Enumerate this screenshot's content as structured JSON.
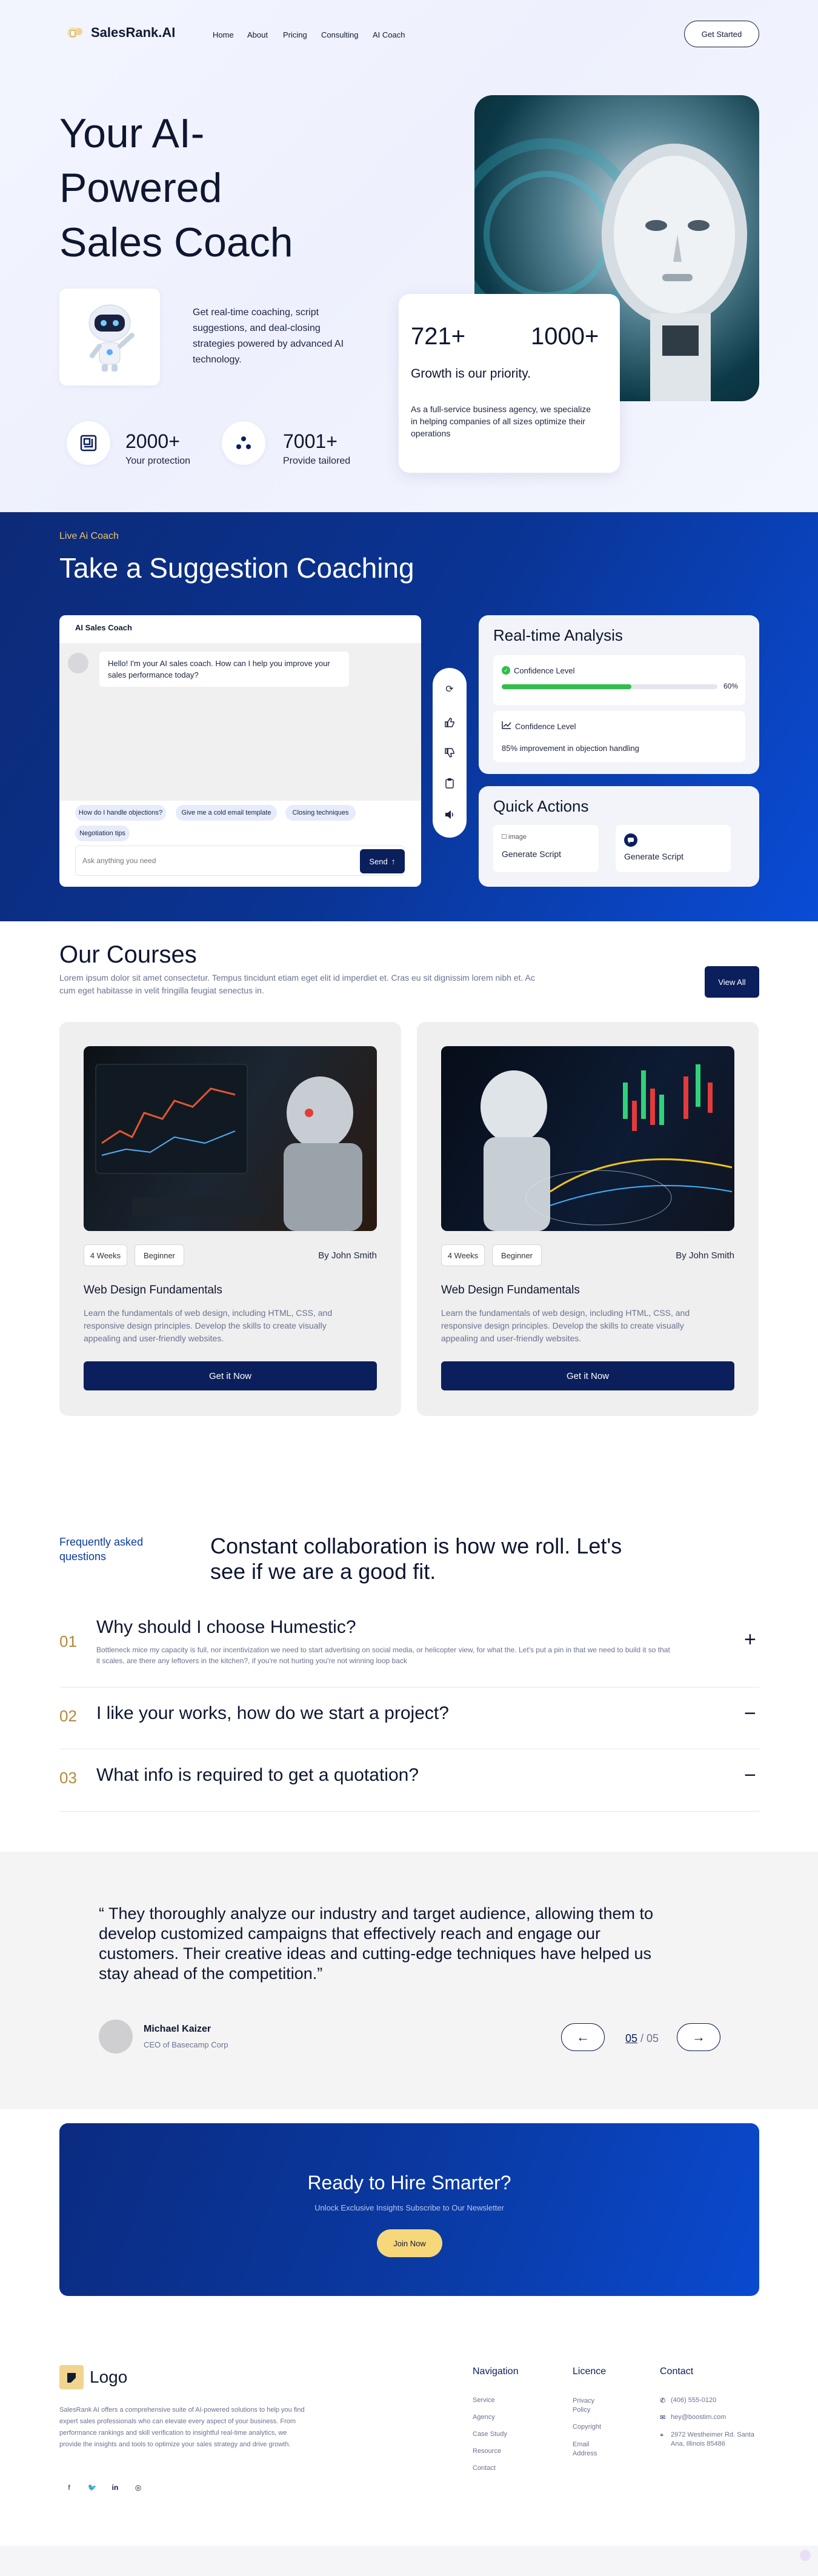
{
  "brand": {
    "name": "SalesRank.AI"
  },
  "nav": {
    "links": [
      "Home",
      "About",
      "Pricing",
      "Consulting",
      "AI Coach"
    ],
    "cta": "Get Started"
  },
  "hero": {
    "title_lines": [
      "Your AI-",
      "Powered",
      "Sales Coach"
    ],
    "description": "Get real-time coaching, script suggestions, and deal-closing strategies powered by advanced AI technology.",
    "stats": [
      {
        "value": "2000+",
        "label": "Your protection",
        "icon": "layout-icon"
      },
      {
        "value": "7001+",
        "label": "Provide tailored",
        "icon": "dots-icon"
      }
    ],
    "growth_card": {
      "num1": "721+",
      "num2": "1000+",
      "title": "Growth is our priority.",
      "text": "As a full-service business agency, we specialize in helping companies of all sizes optimize their operations"
    }
  },
  "coaching": {
    "eyebrow": "Live Ai Coach",
    "title": "Take a Suggestion Coaching",
    "chat": {
      "header": "AI Sales Coach",
      "message": "Hello! I'm your AI sales coach. How can I help you improve your sales performance today?",
      "chips": [
        "How do I handle objections?",
        "Give me a cold email template",
        "Closing techniques",
        "Negotiation tips"
      ],
      "input_placeholder": "Ask anything you need",
      "send": "Send"
    },
    "toolbar_icons": [
      "refresh-icon",
      "thumbs-up-icon",
      "thumbs-down-icon",
      "clipboard-icon",
      "speaker-icon"
    ],
    "analysis": {
      "title": "Real-time Analysis",
      "confidence_label": "Confidence Level",
      "confidence_value": "60%",
      "confidence_fraction": 0.6,
      "second_label": "Confidence Level",
      "second_text": "85% improvement in objection handling"
    },
    "quick_actions": {
      "title": "Quick Actions",
      "items": [
        {
          "img_alt": "image",
          "label": "Generate Script"
        },
        {
          "img_alt": "",
          "label": "Generate Script"
        }
      ]
    }
  },
  "courses": {
    "title": "Our Courses",
    "description": "Lorem ipsum dolor sit amet consectetur. Tempus tincidunt etiam eget elit id imperdiet et. Cras eu sit dignissim lorem nibh et. Ac cum eget habitasse in velit fringilla feugiat senectus in.",
    "view_all": "View All",
    "items": [
      {
        "tags": [
          "4 Weeks",
          "Beginner"
        ],
        "author": "By John Smith",
        "title": "Web Design Fundamentals",
        "text": "Learn the fundamentals of web design, including HTML, CSS, and responsive design principles. Develop the skills to create visually appealing and user-friendly websites.",
        "button": "Get it Now"
      },
      {
        "tags": [
          "4 Weeks",
          "Beginner"
        ],
        "author": "By John Smith",
        "title": "Web Design Fundamentals",
        "text": "Learn the fundamentals of web design, including HTML, CSS, and responsive design principles. Develop the skills to create visually appealing and user-friendly websites.",
        "button": "Get it Now"
      }
    ]
  },
  "faq": {
    "eyebrow": "Frequently asked questions",
    "headline": "Constant collaboration is how we roll. Let's see if we are a good fit.",
    "items": [
      {
        "num": "01",
        "q": "Why should I choose Humestic?",
        "toggle": "+",
        "answer": "Bottleneck mice my capacity is full, nor incentivization we need to start advertising on social media, or helicopter view, for what the. Let's put a pin in that we need to build it so that it scales, are there any leftovers in the kitchen?, if you're not hurting you're not winning loop back"
      },
      {
        "num": "02",
        "q": "I like your works, how do we start a project?",
        "toggle": "−",
        "answer": ""
      },
      {
        "num": "03",
        "q": "What info is required to get a quotation?",
        "toggle": "−",
        "answer": ""
      }
    ]
  },
  "testimonial": {
    "quote": "“ They thoroughly analyze our industry and target audience, allowing them to develop customized campaigns that effectively reach and engage our customers. Their creative ideas and cutting-edge techniques have helped us stay ahead of the competition.”",
    "name": "Michael Kaizer",
    "role": "CEO of Basecamp Corp",
    "current": "05",
    "total": "05",
    "sep": " / "
  },
  "cta": {
    "title": "Ready to Hire Smarter?",
    "subtitle": "Unlock Exclusive Insights Subscribe to Our Newsletter",
    "button": "Join Now"
  },
  "footer": {
    "logo": "Logo",
    "about": "SalesRank AI offers a comprehensive suite of AI-powered solutions to help you find expert sales professionals who can elevate every aspect of your business. From performance rankings and skill verification to insightful real-time analytics, we provide the insights and tools to optimize your sales strategy and drive growth.",
    "navigation": {
      "title": "Navigation",
      "links": [
        "Service",
        "Agency",
        "Case Study",
        "Resource",
        "Contact"
      ]
    },
    "licence": {
      "title": "Licence",
      "links": [
        "Privacy Policy",
        "Copyright",
        "Email Address"
      ]
    },
    "contact": {
      "title": "Contact",
      "phone": "(406) 555-0120",
      "email": "hey@boostim.com",
      "address": "2972 Westheimer Rd. Santa Ana, Illinois 85486"
    },
    "social_icons": [
      "facebook-icon",
      "twitter-icon",
      "linkedin-icon",
      "instagram-icon"
    ]
  },
  "colors": {
    "navy": "#0b1f5c",
    "accent_blue": "#0a4ad0",
    "gold": "#b6893a",
    "green": "#2fbf4a",
    "cta_yellow": "#f6d77a"
  }
}
